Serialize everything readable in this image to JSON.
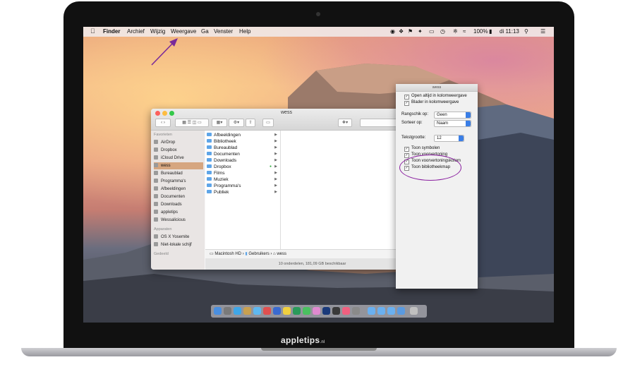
{
  "menubar": {
    "app": "Finder",
    "items": [
      "Archief",
      "Wijzig",
      "Weergave",
      "Ga",
      "Venster",
      "Help"
    ],
    "battery": "100%",
    "clock": "di 11:13"
  },
  "finder": {
    "title": "wess",
    "search_placeholder": "Zoe",
    "sidebar": {
      "favorites_header": "Favorieten",
      "favorites": [
        "AirDrop",
        "Dropbox",
        "iCloud Drive",
        "wess",
        "Bureaublad",
        "Programma's",
        "Afbeeldingen",
        "Documenten",
        "Downloads",
        "appletips",
        "Wessalicious"
      ],
      "devices_header": "Apparaten",
      "devices": [
        "OS X Yosemite",
        "Niet-lokale schijf"
      ],
      "shared_header": "Gedeeld"
    },
    "column": [
      "Afbeeldingen",
      "Bibliotheek",
      "Bureaublad",
      "Documenten",
      "Downloads",
      "Dropbox",
      "Films",
      "Muziek",
      "Programma's",
      "Publiek"
    ],
    "path": [
      "Macintosh HD",
      "Gebruikers",
      "wess"
    ],
    "status": "10 onderdelen, 181,09 GB beschikbaar"
  },
  "view_options": {
    "title": "wess",
    "always_column": "Open altijd in kolomweergave",
    "browse_column": "Blader in kolomweergave",
    "arrange_label": "Rangschik op:",
    "arrange_value": "Geen",
    "sort_label": "Sorteer op:",
    "sort_value": "Naam",
    "textsize_label": "Tekstgrootte:",
    "textsize_value": "12",
    "show_icons": "Toon symbolen",
    "show_preview": "Toon voorvertoning",
    "show_preview_col": "Toon voorvertoningskolom",
    "show_library": "Toon bibliotheekmap"
  },
  "brand": {
    "name": "appletips",
    "tld": ".nl"
  },
  "colors": {
    "accent_arrow": "#7a2a9a",
    "highlight_circle": "#8a1fa0",
    "sidebar_active": "#d6a680"
  }
}
